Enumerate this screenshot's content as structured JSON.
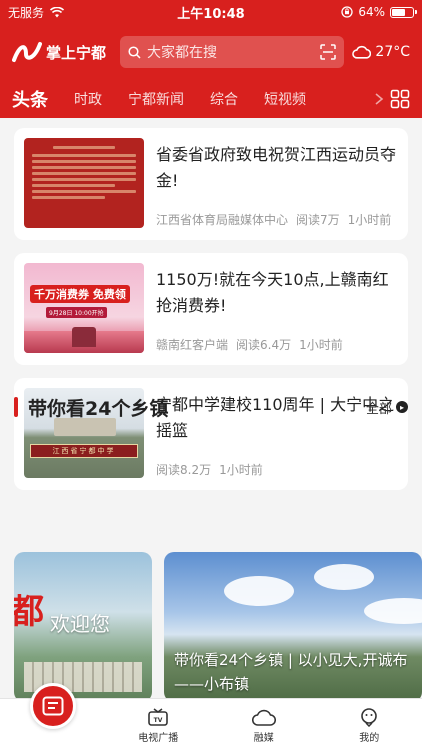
{
  "status_bar": {
    "carrier": "无服务",
    "time": "上午10:48",
    "battery": "64%",
    "battery_level": 0.64
  },
  "header": {
    "app_name": "掌上宁都",
    "search_placeholder": "大家都在搜",
    "weather_temp": "27°C"
  },
  "tabs": [
    {
      "label": "头条",
      "active": true
    },
    {
      "label": "时政",
      "active": false
    },
    {
      "label": "宁都新闻",
      "active": false
    },
    {
      "label": "综合",
      "active": false
    },
    {
      "label": "短视频",
      "active": false
    }
  ],
  "news": [
    {
      "title": "省委省政府致电祝贺江西运动员夺金!",
      "source": "江西省体育局融媒体中心",
      "reads": "阅读7万",
      "time": "1小时前"
    },
    {
      "title": "1150万!就在今天10点,上赣南红抢消费券!",
      "source": "赣南红客户端",
      "reads": "阅读6.4万",
      "time": "1小时前",
      "thumb_text": "千万消费券 免费领",
      "thumb_date": "9月28日 10:00开抢"
    },
    {
      "title": "宁都中学建校110周年 | 大宁中之摇篮",
      "source": "",
      "reads": "阅读8.2万",
      "time": "1小时前",
      "thumb_text": "江西省宁都中学"
    }
  ],
  "section": {
    "title": "带你看24个乡镇",
    "all_label": "全部"
  },
  "towns": [
    {
      "big_text": "都",
      "overlay": "欢迎您"
    },
    {
      "caption_line1": "带你看24个乡镇 | 以小见大,开诚布",
      "caption_line2": "——小布镇"
    }
  ],
  "bottom_nav": [
    {
      "label": "",
      "icon": "home-news-icon"
    },
    {
      "label": "电视广播",
      "icon": "tv-icon"
    },
    {
      "label": "融媒",
      "icon": "cloud-icon"
    },
    {
      "label": "我的",
      "icon": "profile-icon"
    }
  ],
  "colors": {
    "brand_red": "#d8201e",
    "background": "#f4f4f4"
  }
}
